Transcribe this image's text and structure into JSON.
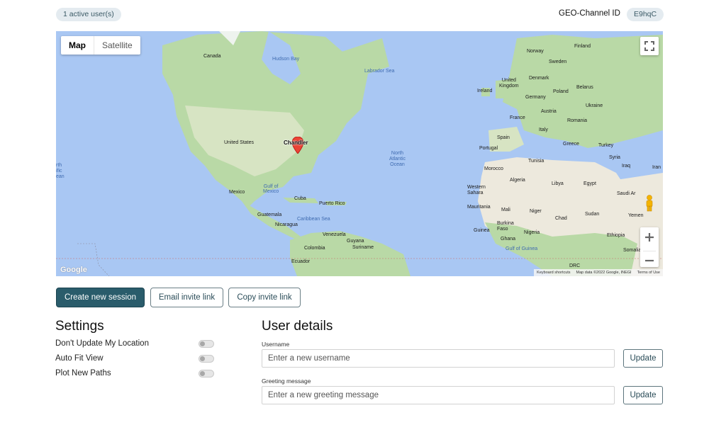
{
  "header": {
    "active_users": "1 active user(s)",
    "channel_label": "GEO-Channel ID",
    "channel_id": "E9hqC"
  },
  "map": {
    "type_map": "Map",
    "type_satellite": "Satellite",
    "marker_city": "Chandler",
    "google_logo": "Google",
    "footer": {
      "shortcuts": "Keyboard shortcuts",
      "map_data": "Map data ©2022 Google, INEGI",
      "terms": "Terms of Use"
    },
    "labels": {
      "canada": "Canada",
      "hudson_bay": "Hudson Bay",
      "labrador_sea": "Labrador Sea",
      "united_states": "United States",
      "mexico": "Mexico",
      "gulf_of_mexico": "Gulf of\nMexico",
      "cuba": "Cuba",
      "puerto_rico": "Puerto Rico",
      "guatemala": "Guatemala",
      "nicaragua": "Nicaragua",
      "caribbean_sea": "Caribbean Sea",
      "venezuela": "Venezuela",
      "colombia": "Colombia",
      "guyana": "Guyana",
      "suriname": "Suriname",
      "ecuador": "Ecuador",
      "north_atlantic": "North\nAtlantic\nOcean",
      "north_pacific": "rth\nific\nean",
      "finland": "Finland",
      "norway": "Norway",
      "sweden": "Sweden",
      "united_kingdom": "United\nKingdom",
      "ireland": "Ireland",
      "denmark": "Denmark",
      "belarus": "Belarus",
      "poland": "Poland",
      "germany": "Germany",
      "ukraine": "Ukraine",
      "france": "France",
      "austria": "Austria",
      "italy": "Italy",
      "romania": "Romania",
      "spain": "Spain",
      "portugal": "Portugal",
      "greece": "Greece",
      "turkey": "Turkey",
      "tunisia": "Tunisia",
      "morocco": "Morocco",
      "syria": "Syria",
      "iraq": "Iraq",
      "iran": "Iran",
      "western_sahara": "Western\nSahara",
      "algeria": "Algeria",
      "libya": "Libya",
      "egypt": "Egypt",
      "saudi_arabia": "Saudi Ar",
      "mauritania": "Mauritania",
      "mali": "Mali",
      "niger": "Niger",
      "chad": "Chad",
      "sudan": "Sudan",
      "yemen": "Yemen",
      "guinea": "Guinea",
      "burkina_faso": "Burkina\nFaso",
      "nigeria": "Nigeria",
      "ethiopia": "Ethiopia",
      "ghana": "Ghana",
      "gulf_of_guinea": "Gulf of Guinea",
      "somalia": "Somalia",
      "drc": "DRC"
    }
  },
  "actions": {
    "create_session": "Create new session",
    "email_invite": "Email invite link",
    "copy_invite": "Copy invite link"
  },
  "settings": {
    "title": "Settings",
    "items": [
      {
        "label": "Don't Update My Location",
        "enabled": false
      },
      {
        "label": "Auto Fit View",
        "enabled": false
      },
      {
        "label": "Plot New Paths",
        "enabled": false
      }
    ]
  },
  "user_details": {
    "title": "User details",
    "username_label": "Username",
    "username_placeholder": "Enter a new username",
    "greeting_label": "Greeting message",
    "greeting_placeholder": "Enter a new greeting message",
    "update_label": "Update"
  },
  "colors": {
    "primary": "#2a5c6b",
    "ocean": "#a9c7f3",
    "land": "#b9d9a6",
    "desert": "#ede9dd",
    "marker": "#ea4335"
  }
}
